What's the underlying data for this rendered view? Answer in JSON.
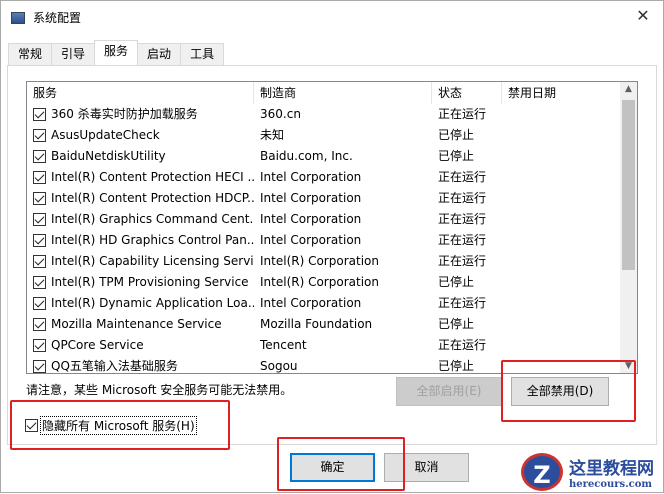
{
  "window": {
    "title": "系统配置",
    "close": "✕"
  },
  "tabs": [
    {
      "label": "常规"
    },
    {
      "label": "引导"
    },
    {
      "label": "服务",
      "active": true
    },
    {
      "label": "启动"
    },
    {
      "label": "工具"
    }
  ],
  "columns": [
    "服务",
    "制造商",
    "状态",
    "禁用日期"
  ],
  "rows": [
    {
      "service": "360 杀毒实时防护加载服务",
      "maker": "360.cn",
      "status": "正在运行"
    },
    {
      "service": "AsusUpdateCheck",
      "maker": "未知",
      "status": "已停止"
    },
    {
      "service": "BaiduNetdiskUtility",
      "maker": "Baidu.com, Inc.",
      "status": "已停止"
    },
    {
      "service": "Intel(R) Content Protection HECI ...",
      "maker": "Intel Corporation",
      "status": "正在运行"
    },
    {
      "service": "Intel(R) Content Protection HDCP...",
      "maker": "Intel Corporation",
      "status": "正在运行"
    },
    {
      "service": "Intel(R) Graphics Command Cent...",
      "maker": "Intel Corporation",
      "status": "正在运行"
    },
    {
      "service": "Intel(R) HD Graphics Control Pan...",
      "maker": "Intel Corporation",
      "status": "正在运行"
    },
    {
      "service": "Intel(R) Capability Licensing Servi...",
      "maker": "Intel(R) Corporation",
      "status": "正在运行"
    },
    {
      "service": "Intel(R) TPM Provisioning Service",
      "maker": "Intel(R) Corporation",
      "status": "已停止"
    },
    {
      "service": "Intel(R) Dynamic Application Loa...",
      "maker": "Intel Corporation",
      "status": "正在运行"
    },
    {
      "service": "Mozilla Maintenance Service",
      "maker": "Mozilla Foundation",
      "status": "已停止"
    },
    {
      "service": "QPCore Service",
      "maker": "Tencent",
      "status": "正在运行"
    },
    {
      "service": "QQ五笔输入法基础服务",
      "maker": "Sogou",
      "status": "已停止"
    }
  ],
  "note": "请注意，某些 Microsoft 安全服务可能无法禁用。",
  "buttons": {
    "enable_all": "全部启用(E)",
    "disable_all": "全部禁用(D)",
    "ok": "确定",
    "cancel": "取消"
  },
  "hide_ms": {
    "label": "隐藏所有 Microsoft 服务(H)",
    "checked": true
  },
  "watermark": {
    "logo": "Z",
    "name": "这里教程网",
    "url": "herecours.com"
  }
}
